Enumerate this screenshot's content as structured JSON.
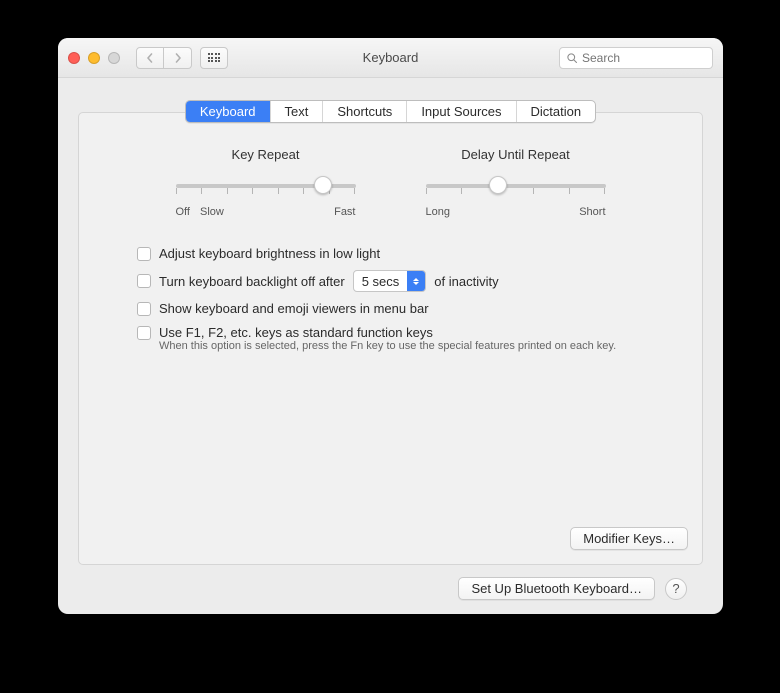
{
  "window": {
    "title": "Keyboard"
  },
  "search": {
    "placeholder": "Search"
  },
  "tabs": [
    "Keyboard",
    "Text",
    "Shortcuts",
    "Input Sources",
    "Dictation"
  ],
  "active_tab": 0,
  "sliders": {
    "key_repeat": {
      "label": "Key Repeat",
      "left_label": "Off",
      "left_label2": "Slow",
      "right_label": "Fast",
      "ticks": 8,
      "value_index": 6
    },
    "delay": {
      "label": "Delay Until Repeat",
      "left_label": "Long",
      "right_label": "Short",
      "ticks": 6,
      "value_index": 2
    }
  },
  "options": {
    "brightness": "Adjust keyboard brightness in low light",
    "backlight_pre": "Turn keyboard backlight off after",
    "backlight_value": "5 secs",
    "backlight_post": "of inactivity",
    "emoji_viewer": "Show keyboard and emoji viewers in menu bar",
    "fn_keys": "Use F1, F2, etc. keys as standard function keys",
    "fn_hint": "When this option is selected, press the Fn key to use the special features printed on each key."
  },
  "buttons": {
    "modifier": "Modifier Keys…",
    "bluetooth": "Set Up Bluetooth Keyboard…",
    "help": "?"
  }
}
